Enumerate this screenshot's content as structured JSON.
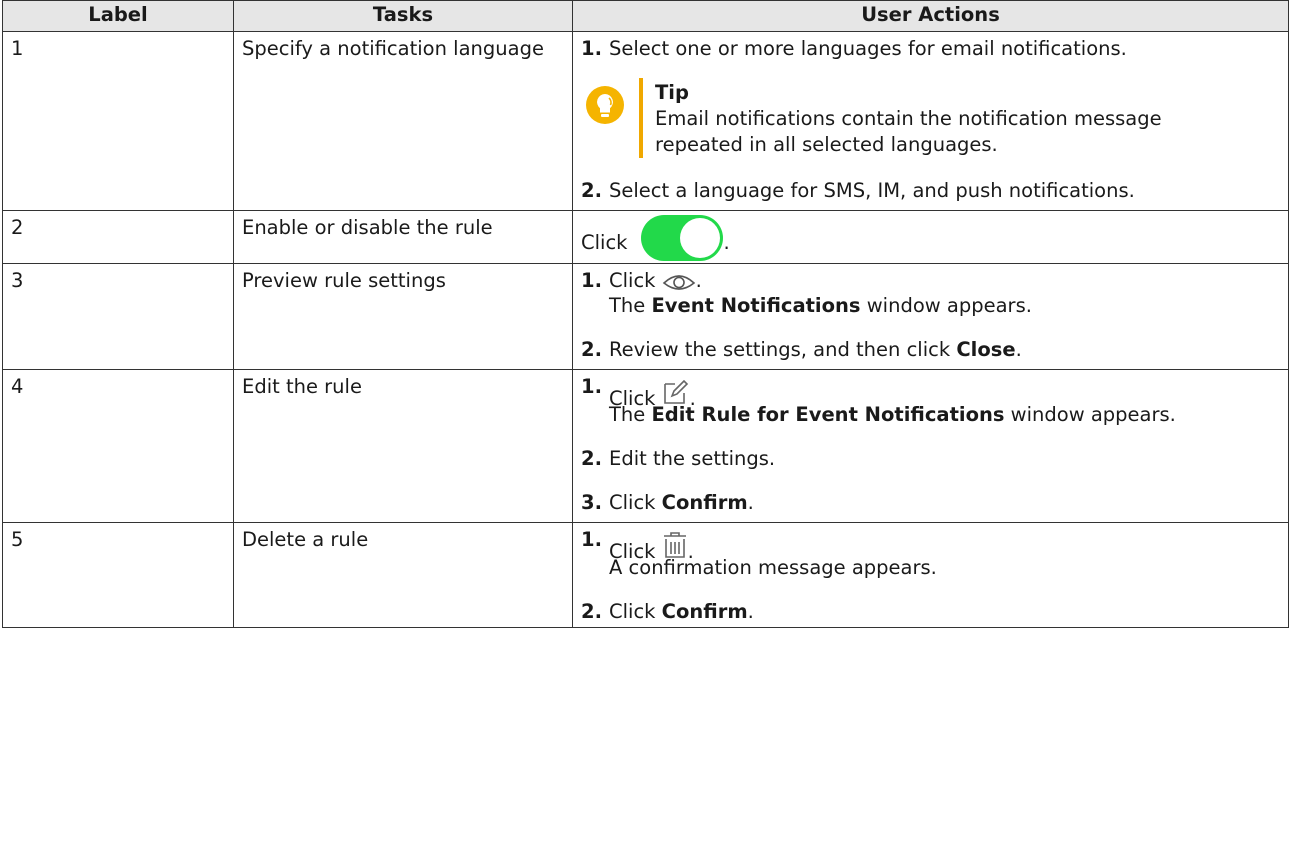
{
  "headers": {
    "label": "Label",
    "tasks": "Tasks",
    "actions": "User Actions"
  },
  "rows": [
    {
      "label": "1",
      "task": "Specify a notification language",
      "step1_num": "1.",
      "step1_text": "Select one or more languages for email notifications.",
      "tip_title": "Tip",
      "tip_text": "Email notifications contain the notification message repeated in all selected languages.",
      "step2_num": "2.",
      "step2_text": "Select a language for SMS, IM, and push notifications."
    },
    {
      "label": "2",
      "task": "Enable or disable the rule",
      "click": "Click",
      "period": ".",
      "toggle_color": "#22d94a"
    },
    {
      "label": "3",
      "task": "Preview rule settings",
      "step1_num": "1.",
      "step1_click": "Click",
      "step1_period": ".",
      "step1_pre": "The ",
      "step1_bold": "Event Notifications",
      "step1_post": " window appears.",
      "step2_num": "2.",
      "step2_pre": "Review the settings, and then click ",
      "step2_bold": "Close",
      "step2_post": "."
    },
    {
      "label": "4",
      "task": "Edit the rule",
      "step1_num": "1.",
      "step1_click": "Click",
      "step1_period": ".",
      "step1_pre": "The ",
      "step1_bold": "Edit Rule for Event Notifications",
      "step1_post": " window appears.",
      "step2_num": "2.",
      "step2_text": "Edit the settings.",
      "step3_num": "3.",
      "step3_pre": "Click ",
      "step3_bold": "Confirm",
      "step3_post": "."
    },
    {
      "label": "5",
      "task": "Delete a rule",
      "step1_num": "1.",
      "step1_click": "Click",
      "step1_period": ".",
      "step1_text": "A confirmation message appears.",
      "step2_num": "2.",
      "step2_pre": "Click ",
      "step2_bold": "Confirm",
      "step2_post": "."
    }
  ],
  "icons": {
    "tip": "lightbulb-icon",
    "toggle": "toggle-switch-icon",
    "preview": "eye-icon",
    "edit": "edit-icon",
    "delete": "trash-icon"
  },
  "colors": {
    "header_bg": "#e6e6e6",
    "tip_accent": "#f0a800",
    "toggle_on": "#22d94a"
  }
}
